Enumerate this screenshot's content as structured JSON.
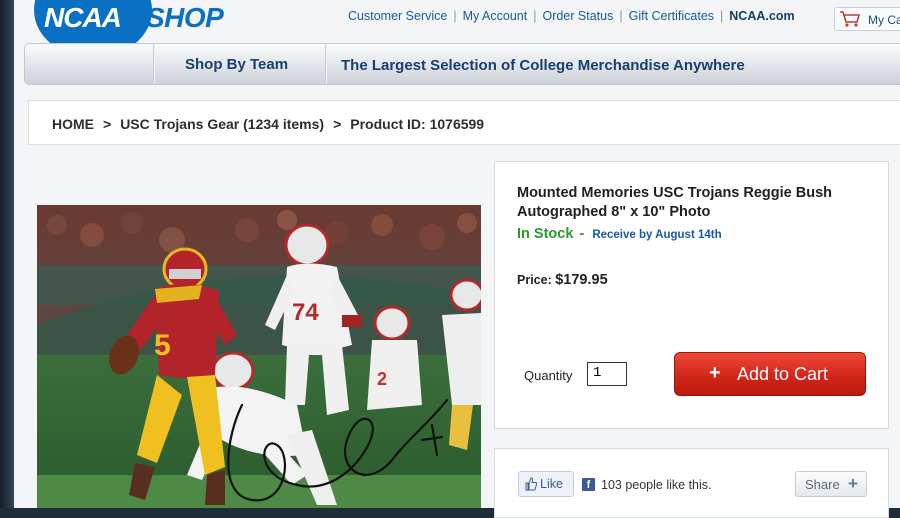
{
  "header": {
    "logo_ncaa": "NCAA",
    "logo_shop": "SHOP",
    "links": [
      "Customer Service",
      "My Account",
      "Order Status",
      "Gift Certificates"
    ],
    "ncaa_link": "NCAA.com",
    "cart_label": "My Ca"
  },
  "nav": {
    "shop_by_team": "Shop By Team",
    "tagline": "The Largest Selection of College Merchandise Anywhere"
  },
  "breadcrumb": {
    "home": "HOME",
    "category": "USC Trojans Gear (1234 items)",
    "product": "Product ID: 1076599",
    "separator": ">"
  },
  "product": {
    "title": "Mounted Memories USC Trojans Reggie Bush Autographed 8\" x 10\" Photo",
    "stock": "In Stock",
    "stock_dash": "-",
    "receive": "Receive by August 14th",
    "price_label": "Price:",
    "price_value": "$179.95",
    "quantity_label": "Quantity",
    "quantity_value": "1",
    "add_to_cart": "Add to Cart",
    "add_plus": "+"
  },
  "social": {
    "like_label": "Like",
    "likes_text": "103 people like this.",
    "share_label": "Share",
    "icons": [
      "thumbs-up-icon",
      "facebook-icon",
      "plus-icon"
    ]
  },
  "photo": {
    "jersey_number_back": "5",
    "jersey_number_front": "74",
    "colors": {
      "usc_cardinal": "#b3242a",
      "usc_gold": "#f0c020",
      "field": "#2f6a35"
    }
  },
  "colors": {
    "brand_blue": "#0a70c4",
    "nav_text": "#1b3e6f",
    "stock_green": "#2a9a2a",
    "cart_red": "#d2261a"
  }
}
